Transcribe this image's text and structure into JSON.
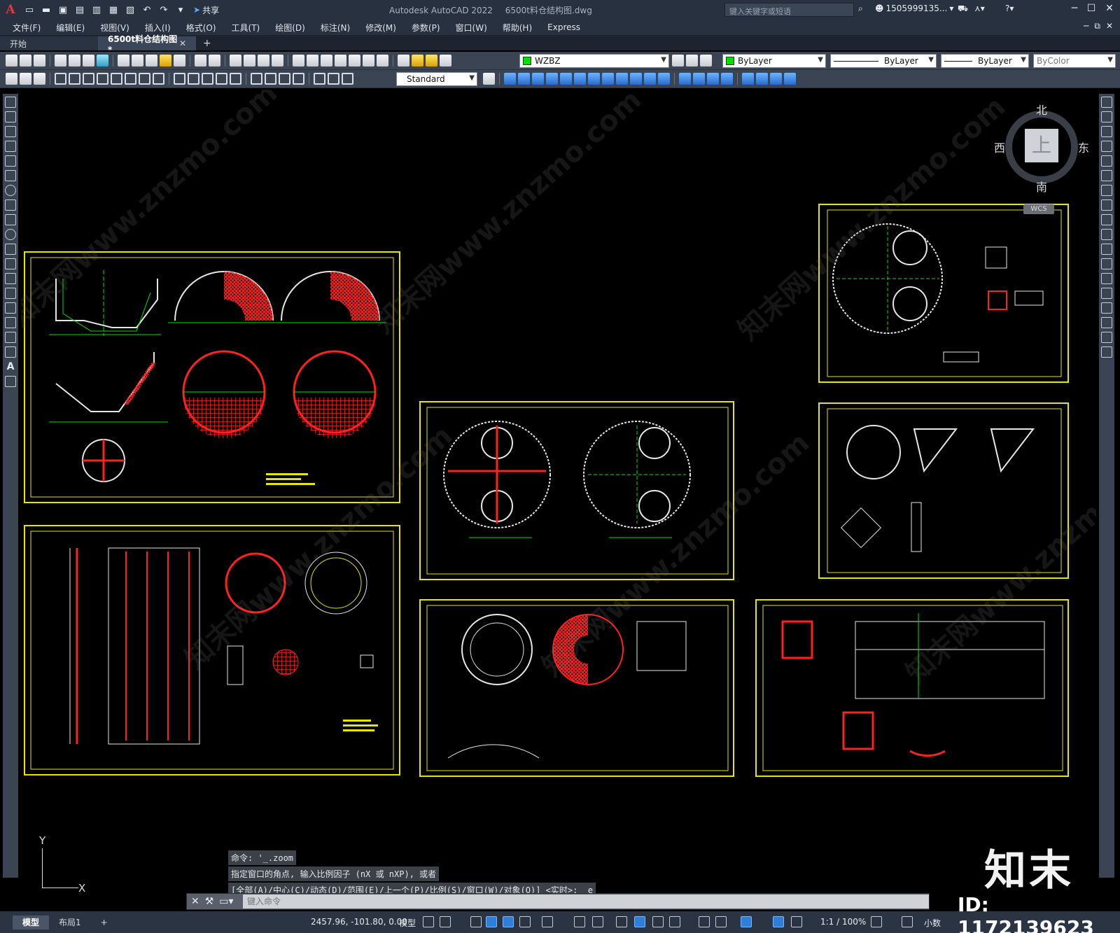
{
  "titlebar": {
    "app_name": "Autodesk AutoCAD 2022",
    "file_name": "6500t料仓结构图.dwg",
    "share_label": "共享",
    "search_placeholder": "键入关键字或短语",
    "user": "1505999135..."
  },
  "menu": {
    "items": [
      "文件(F)",
      "编辑(E)",
      "视图(V)",
      "插入(I)",
      "格式(O)",
      "工具(T)",
      "绘图(D)",
      "标注(N)",
      "修改(M)",
      "参数(P)",
      "窗口(W)",
      "帮助(H)",
      "Express"
    ]
  },
  "tabs": {
    "start": "开始",
    "active": "6500t料仓结构图*"
  },
  "properties": {
    "layer": "WZBZ",
    "layer_color": "#00e000",
    "color": "ByLayer",
    "linetype": "ByLayer",
    "lineweight": "ByLayer",
    "plotstyle": "ByColor",
    "text_style": "Standard"
  },
  "viewcube": {
    "north": "北",
    "south": "南",
    "east": "东",
    "west": "西",
    "face": "上",
    "wcs": "WCS"
  },
  "ucs": {
    "y": "Y",
    "x": "X"
  },
  "command": {
    "history": [
      "命令: '_.zoom",
      "指定窗口的角点, 输入比例因子 (nX 或 nXP), 或者",
      "[全部(A)/中心(C)/动态(D)/范围(E)/上一个(P)/比例(S)/窗口(W)/对象(O)] <实时>: _e"
    ],
    "input_placeholder": "键入命令"
  },
  "statusbar": {
    "model_tab": "模型",
    "layout_tab": "布局1",
    "coords": "2457.96, -101.80, 0.00",
    "mode": "模型",
    "scale": "1:1 / 100%",
    "units": "小数"
  },
  "brand": {
    "logo": "知末",
    "id": "ID: 1172139623",
    "watermark": "知末网www.znzmo.com"
  },
  "colors": {
    "sheet_border": "#e6e600",
    "canvas": "#000000",
    "rebar_red": "#ff2020",
    "dim_green": "#00e000"
  }
}
